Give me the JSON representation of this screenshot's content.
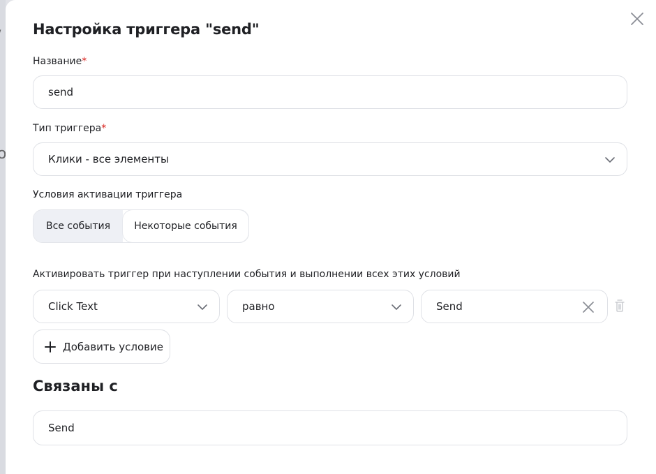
{
  "dialog": {
    "title": "Настройка триггера \"send\"",
    "close_icon": "close-icon"
  },
  "name_field": {
    "label": "Название",
    "required_mark": "*",
    "value": "send"
  },
  "trigger_type": {
    "label": "Тип триггера",
    "required_mark": "*",
    "selected": "Клики - все элементы"
  },
  "activation": {
    "label": "Условия активации триггера",
    "options": [
      "Все события",
      "Некоторые события"
    ],
    "active_option": "Все события"
  },
  "conditions": {
    "label": "Активировать триггер при наступлении события и выполнении всех этих условий",
    "rows": [
      {
        "variable": "Click Text",
        "operator": "равно",
        "value": "Send"
      }
    ],
    "add_label": "Добавить условие"
  },
  "linked": {
    "title": "Связаны с",
    "value": "Send"
  },
  "colors": {
    "required": "#d9211c",
    "border": "#dfe1e6",
    "active_segment": "#eef0f5"
  }
}
